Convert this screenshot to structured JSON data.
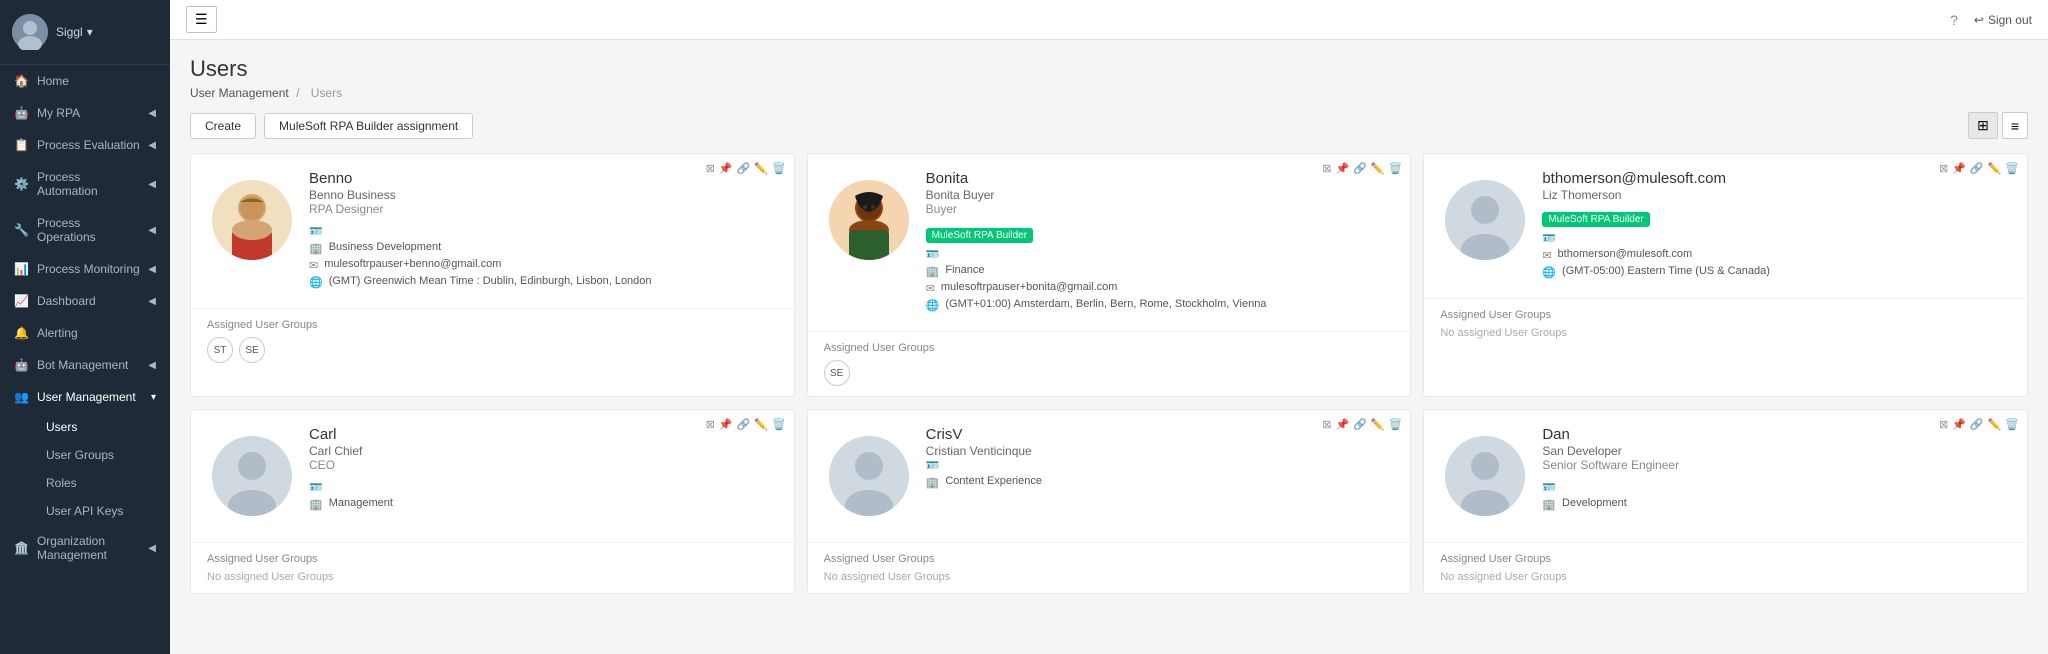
{
  "sidebar": {
    "user": "Siggl",
    "items": [
      {
        "id": "home",
        "label": "Home",
        "icon": "🏠",
        "hasChevron": false
      },
      {
        "id": "my-rpa",
        "label": "My RPA",
        "icon": "🤖",
        "hasChevron": true
      },
      {
        "id": "process-evaluation",
        "label": "Process Evaluation",
        "icon": "📋",
        "hasChevron": true
      },
      {
        "id": "process-automation",
        "label": "Process Automation",
        "icon": "⚙️",
        "hasChevron": true
      },
      {
        "id": "process-operations",
        "label": "Process Operations",
        "icon": "🔧",
        "hasChevron": true
      },
      {
        "id": "process-monitoring",
        "label": "Process Monitoring",
        "icon": "📊",
        "hasChevron": true
      },
      {
        "id": "dashboard",
        "label": "Dashboard",
        "icon": "📈",
        "hasChevron": true
      },
      {
        "id": "alerting",
        "label": "Alerting",
        "icon": "🔔",
        "hasChevron": false
      },
      {
        "id": "bot-management",
        "label": "Bot Management",
        "icon": "🤖",
        "hasChevron": true
      },
      {
        "id": "user-management",
        "label": "User Management",
        "icon": "👥",
        "hasChevron": true,
        "active": true
      }
    ],
    "subItems": [
      {
        "id": "users",
        "label": "Users",
        "active": true
      },
      {
        "id": "user-groups",
        "label": "User Groups"
      },
      {
        "id": "roles",
        "label": "Roles"
      },
      {
        "id": "user-api-keys",
        "label": "User API Keys"
      }
    ],
    "orgItem": {
      "id": "org-management",
      "label": "Organization Management",
      "icon": "🏛️",
      "hasChevron": true
    }
  },
  "topbar": {
    "menu_icon": "☰",
    "help_icon": "?",
    "signout_label": "Sign out"
  },
  "page": {
    "title": "Users",
    "breadcrumb_parent": "User Management",
    "breadcrumb_current": "Users"
  },
  "actions": {
    "create_label": "Create",
    "assignment_label": "MuleSoft RPA Builder assignment"
  },
  "users": [
    {
      "id": "benno",
      "name": "Benno",
      "org": "Benno Business",
      "role": "RPA Designer",
      "department": "Business Development",
      "email": "mulesoftrpauser+benno@gmail.com",
      "timezone": "(GMT) Greenwich Mean Time : Dublin, Edinburgh, Lisbon, London",
      "has_badge": false,
      "avatar_type": "benno",
      "groups": [
        "ST",
        "SE"
      ]
    },
    {
      "id": "bonita",
      "name": "Bonita",
      "org": "Bonita Buyer",
      "role": "Buyer",
      "department": "Finance",
      "email": "mulesoftrpauser+bonita@gmail.com",
      "timezone": "(GMT+01:00) Amsterdam, Berlin, Bern, Rome, Stockholm, Vienna",
      "has_badge": true,
      "badge_text": "MuleSoft RPA Builder",
      "avatar_type": "bonita",
      "groups": [
        "SE"
      ]
    },
    {
      "id": "bthomerson",
      "name": "bthomerson@mulesoft.com",
      "org": "Liz Thomerson",
      "role": "",
      "department": "",
      "email": "bthomerson@mulesoft.com",
      "timezone": "(GMT-05:00) Eastern Time (US & Canada)",
      "has_badge": true,
      "badge_text": "MuleSoft RPA Builder",
      "avatar_type": "generic",
      "groups": []
    },
    {
      "id": "carl",
      "name": "Carl",
      "org": "Carl Chief",
      "role": "CEO",
      "department": "Management",
      "email": "",
      "timezone": "",
      "has_badge": false,
      "avatar_type": "generic",
      "groups": []
    },
    {
      "id": "crisv",
      "name": "CrisV",
      "org": "Cristian Venticinque",
      "role": "",
      "department": "Content Experience",
      "email": "",
      "timezone": "",
      "has_badge": false,
      "avatar_type": "generic",
      "groups": []
    },
    {
      "id": "dan",
      "name": "Dan",
      "org": "San Developer",
      "role": "Senior Software Engineer",
      "department": "Development",
      "email": "",
      "timezone": "",
      "has_badge": false,
      "avatar_type": "generic",
      "groups": []
    }
  ],
  "icons": {
    "filter": "⊞",
    "pin": "📌",
    "link": "🔗",
    "edit": "✏️",
    "delete": "🗑️",
    "grid_view": "⊞",
    "list_view": "☰"
  }
}
